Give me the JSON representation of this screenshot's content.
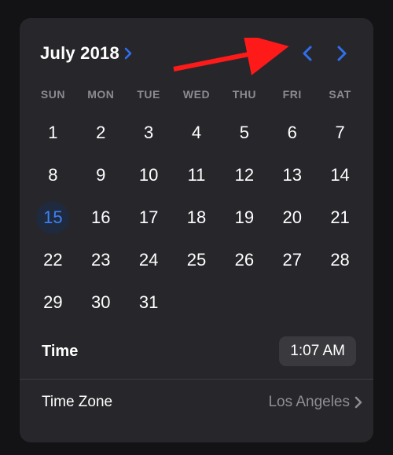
{
  "colors": {
    "accent": "#2f6ff0",
    "annotation": "#ff1a1a"
  },
  "header": {
    "month_label": "July 2018"
  },
  "weekdays": [
    "SUN",
    "MON",
    "TUE",
    "WED",
    "THU",
    "FRI",
    "SAT"
  ],
  "calendar": {
    "leading_blanks": 0,
    "days": [
      1,
      2,
      3,
      4,
      5,
      6,
      7,
      8,
      9,
      10,
      11,
      12,
      13,
      14,
      15,
      16,
      17,
      18,
      19,
      20,
      21,
      22,
      23,
      24,
      25,
      26,
      27,
      28,
      29,
      30,
      31
    ],
    "selected_day": 15
  },
  "time": {
    "label": "Time",
    "value": "1:07 AM"
  },
  "time_zone": {
    "label": "Time Zone",
    "value": "Los Angeles"
  }
}
